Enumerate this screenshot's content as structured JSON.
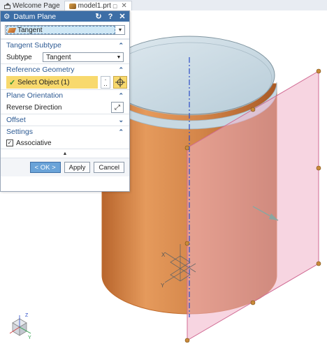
{
  "tabs": [
    {
      "label": "Welcome Page",
      "icon": "home-icon"
    },
    {
      "label": "model1.prt",
      "icon": "model-icon",
      "pin": "□",
      "close": "✕"
    }
  ],
  "dialog": {
    "title": "Datum Plane",
    "type_combo": {
      "value": "Tangent",
      "icon": "tangent-plane-icon"
    },
    "sections": {
      "tangent_subtype": "Tangent Subtype",
      "reference_geometry": "Reference Geometry",
      "plane_orientation": "Plane Orientation",
      "offset": "Offset",
      "settings": "Settings"
    },
    "subtype": {
      "label": "Subtype",
      "value": "Tangent"
    },
    "select_object": "Select Object (1)",
    "reverse_direction": "Reverse Direction",
    "associative": {
      "label": "Associative",
      "checked": true
    },
    "buttons": {
      "ok": "< OK >",
      "apply": "Apply",
      "cancel": "Cancel"
    }
  },
  "triad_labels": {
    "x": "X",
    "y": "Y",
    "z": "Z"
  },
  "colors": {
    "title_bar": "#3d6ea6",
    "section_header": "#2d5a93",
    "highlight_yellow": "#f8d96d",
    "cylinder": "#d98a4e",
    "plane": "#f1b3c9"
  }
}
